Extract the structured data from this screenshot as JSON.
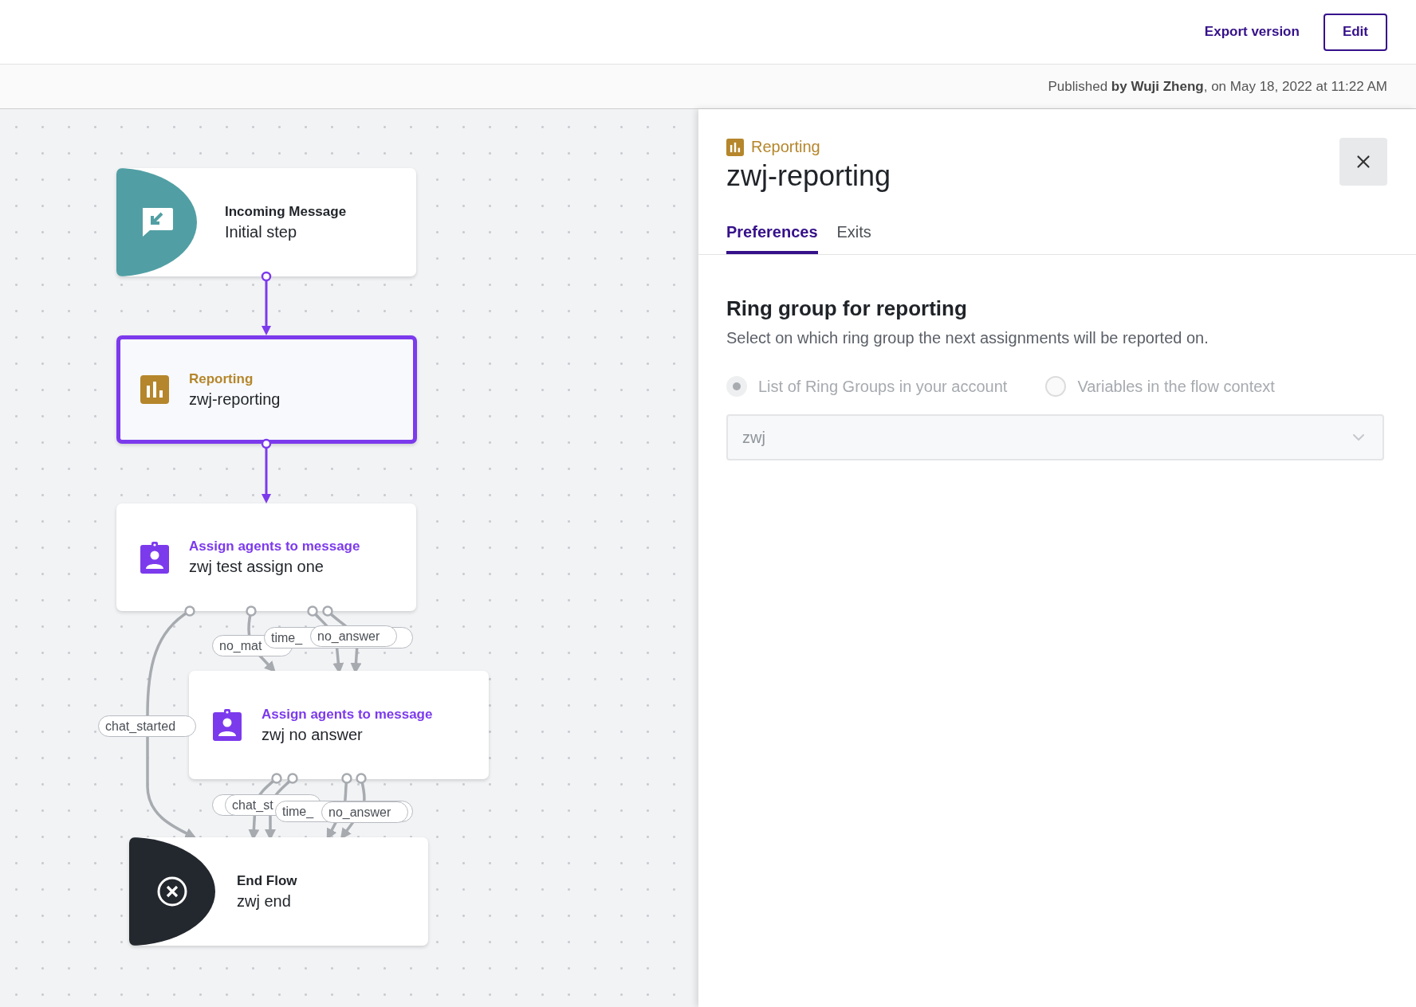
{
  "header": {
    "actions": [
      {
        "kind": "link",
        "label": "Export version"
      },
      {
        "kind": "button",
        "label": "Edit"
      }
    ]
  },
  "publish_bar": {
    "text": "Published **by Wuji Zheng**, on May 18, 2022 at 11:22 AM"
  },
  "canvas": {
    "nodes": [
      {
        "kind": "incoming",
        "type": "Incoming Message",
        "name": "Initial step",
        "selected": false
      },
      {
        "kind": "reporting",
        "type": "Reporting",
        "name": "zwj-reporting",
        "selected": true
      },
      {
        "kind": "assign",
        "type": "Assign agents to message",
        "name": "zwj test assign one",
        "selected": false
      },
      {
        "kind": "assign",
        "type": "Assign agents to message",
        "name": "zwj no answer",
        "selected": false
      },
      {
        "kind": "end",
        "type": "End Flow",
        "name": "zwj end",
        "selected": false
      }
    ],
    "edge_labels": [
      {
        "text": "no_mat"
      },
      {
        "text": "time_"
      },
      {
        "text": "no_answer"
      },
      {
        "text": "chat_started"
      },
      {
        "text": "chat_st"
      },
      {
        "text": "time_"
      },
      {
        "text": "no_answer"
      }
    ]
  },
  "panel": {
    "category": "Reporting",
    "title": "zwj-reporting",
    "tabs": [
      {
        "label": "Preferences",
        "selected": true
      },
      {
        "label": "Exits",
        "selected": false
      }
    ],
    "section": {
      "heading": "Ring group for reporting",
      "description": "Select on which ring group the next assignments will be reported on.",
      "disabled": true,
      "options": [
        {
          "label": "List of Ring Groups in your account",
          "selected": true
        },
        {
          "label": "Variables in the flow context",
          "selected": false
        }
      ],
      "select": {
        "value": "zwj"
      }
    }
  }
}
